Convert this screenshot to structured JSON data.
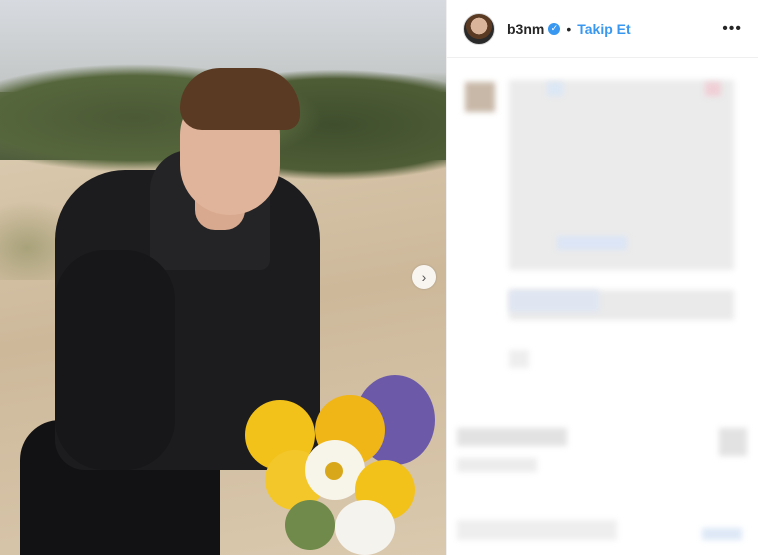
{
  "post": {
    "username": "b3nm",
    "verified_icon": "verified-badge-icon",
    "separator": "•",
    "follow_label": "Takip Et",
    "more_icon": "more-options-icon",
    "more_label": "•••",
    "next_icon": "chevron-right-icon",
    "next_label": "›"
  },
  "colors": {
    "accent": "#3897f0",
    "text": "#262626",
    "border": "#efefef"
  }
}
